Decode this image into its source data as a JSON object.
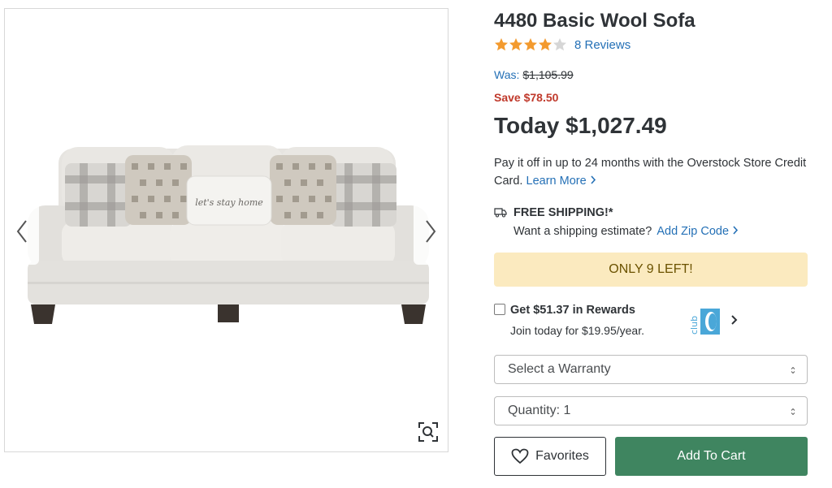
{
  "product": {
    "title": "4480 Basic Wool Sofa",
    "rating": 4,
    "rating_max": 5,
    "reviews": "8 Reviews"
  },
  "pricing": {
    "was_label": "Was:",
    "was_price": "$1,105.99",
    "save": "Save $78.50",
    "today": "Today $1,027.49"
  },
  "credit": {
    "text": "Pay it off in up to 24 months with the Overstock Store Credit Card.",
    "learn_more": "Learn More"
  },
  "shipping": {
    "title": "FREE SHIPPING!*",
    "estimate": "Want a shipping estimate?",
    "zip_link": "Add Zip Code"
  },
  "stock": {
    "text": "ONLY 9 LEFT!"
  },
  "rewards": {
    "title": "Get $51.37 in Rewards",
    "subtitle": "Join today for $19.95/year.",
    "logo_text": "club"
  },
  "warranty": {
    "value": "Select a Warranty"
  },
  "quantity": {
    "value": "Quantity: 1"
  },
  "actions": {
    "favorites": "Favorites",
    "add_to_cart": "Add To Cart"
  },
  "pillow": {
    "text": "let's stay home"
  },
  "colors": {
    "link": "#2470b6",
    "save_red": "#c0392b",
    "star": "#f39a2e",
    "stock_bg": "#fbeabf",
    "cart_green": "#3f8560",
    "club_blue": "#4aa7d8"
  },
  "icons": [
    "chevron-left-icon",
    "chevron-right-icon",
    "zoom-icon",
    "star-icon",
    "shipping-icon",
    "heart-icon",
    "club-logo",
    "select-caret-icon"
  ]
}
